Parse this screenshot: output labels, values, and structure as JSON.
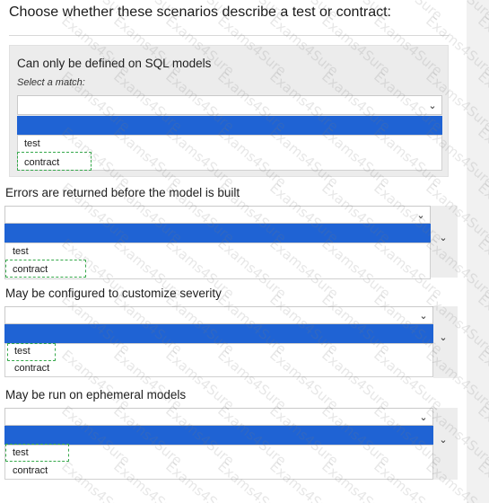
{
  "title": "Choose whether these scenarios describe a test or contract:",
  "select_hint": "Select a match:",
  "questions": [
    {
      "label": "Can only be defined on SQL models",
      "options": [
        "test",
        "contract"
      ],
      "answer": "contract"
    },
    {
      "label": "Errors are returned before the model is built",
      "options": [
        "test",
        "contract"
      ],
      "answer": "contract"
    },
    {
      "label": "May be configured to customize severity",
      "options": [
        "test",
        "contract"
      ],
      "answer": "test"
    },
    {
      "label": "May be run on ephemeral models",
      "options": [
        "test",
        "contract"
      ],
      "answer": "test"
    }
  ],
  "icons": {
    "dropdown": "chevron-down-icon"
  },
  "colors": {
    "highlight_bar": "#1f63d4",
    "answer_box": "#35a84a"
  },
  "watermark": "Exams4Sure"
}
